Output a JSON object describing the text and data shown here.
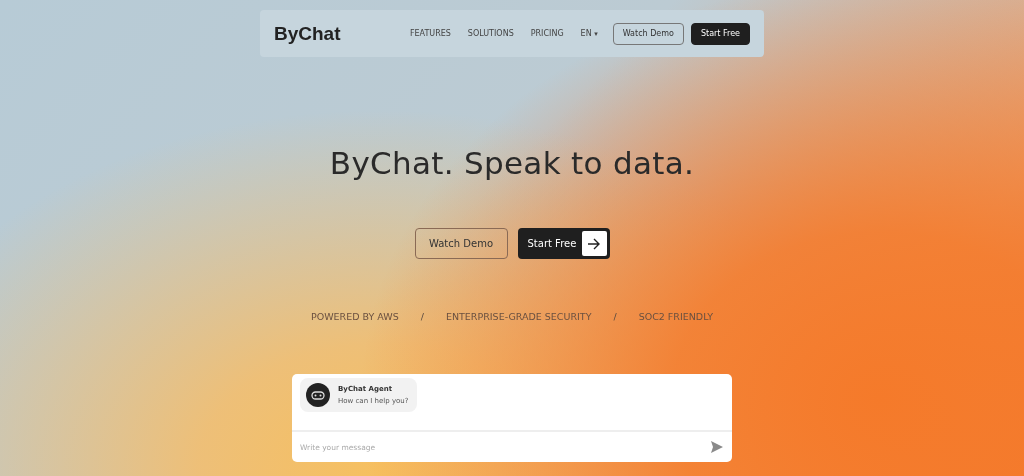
{
  "nav": {
    "logo": "ByChat",
    "links": [
      "FEATURES",
      "SOLUTIONS",
      "PRICING"
    ],
    "language": "EN",
    "language_caret": "▾",
    "buttons": [
      {
        "label": "Watch Demo",
        "kind": "outline"
      },
      {
        "label": "Start Free",
        "kind": "solid"
      }
    ]
  },
  "hero": {
    "title": "ByChat. Speak to data.",
    "buttons": [
      {
        "label": "Watch Demo",
        "kind": "outline"
      },
      {
        "label": "Start Free",
        "kind": "solid-arrow"
      }
    ],
    "trust": [
      {
        "kind": "item",
        "text": "POWERED BY AWS"
      },
      {
        "kind": "separator",
        "text": "/"
      },
      {
        "kind": "item",
        "text": "ENTERPRISE-GRADE SECURITY"
      },
      {
        "kind": "separator",
        "text": "/"
      },
      {
        "kind": "item",
        "text": "SOC2 FRIENDLY"
      }
    ]
  },
  "chat": {
    "messages": [
      {
        "sender": "ByChat Agent",
        "text": "How can I help you?"
      }
    ],
    "input": {
      "placeholder": "Write your message"
    }
  }
}
